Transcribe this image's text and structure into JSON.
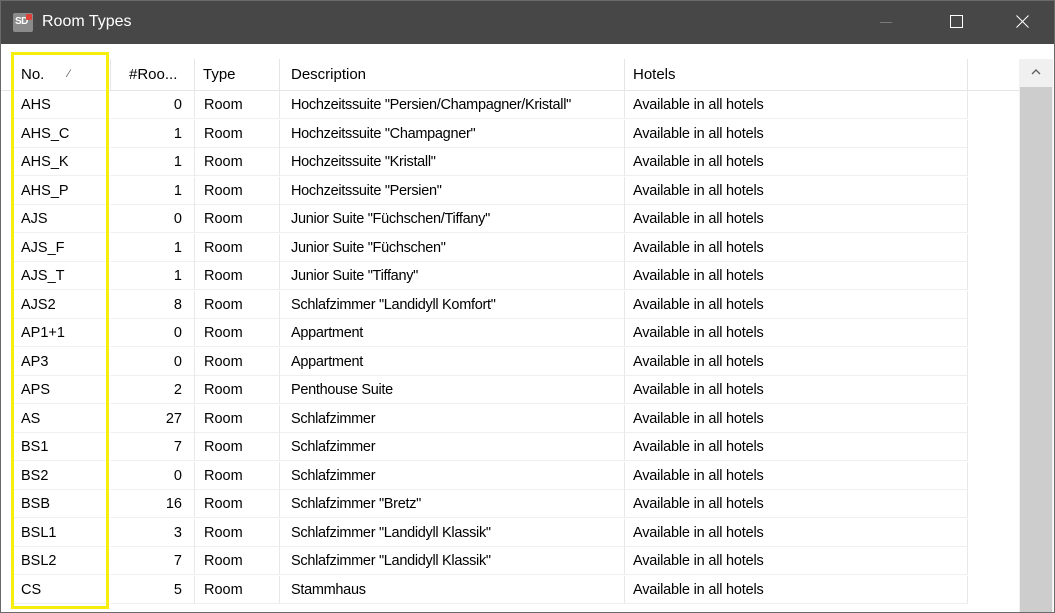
{
  "window": {
    "title": "Room Types",
    "app_icon_text": "SD"
  },
  "columns": {
    "no": "No.",
    "no_sort": "∕",
    "rooms": "#Roo...",
    "type": "Type",
    "description": "Description",
    "hotels": "Hotels"
  },
  "rows": [
    {
      "no": "AHS",
      "rooms": "0",
      "type": "Room",
      "description": "Hochzeitssuite \"Persien/Champagner/Kristall\"",
      "hotels": "Available in all hotels"
    },
    {
      "no": "AHS_C",
      "rooms": "1",
      "type": "Room",
      "description": "Hochzeitssuite \"Champagner\"",
      "hotels": "Available in all hotels"
    },
    {
      "no": "AHS_K",
      "rooms": "1",
      "type": "Room",
      "description": "Hochzeitssuite \"Kristall\"",
      "hotels": "Available in all hotels"
    },
    {
      "no": "AHS_P",
      "rooms": "1",
      "type": "Room",
      "description": "Hochzeitssuite \"Persien\"",
      "hotels": "Available in all hotels"
    },
    {
      "no": "AJS",
      "rooms": "0",
      "type": "Room",
      "description": "Junior Suite \"Füchschen/Tiffany\"",
      "hotels": "Available in all hotels"
    },
    {
      "no": "AJS_F",
      "rooms": "1",
      "type": "Room",
      "description": "Junior Suite \"Füchschen\"",
      "hotels": "Available in all hotels"
    },
    {
      "no": "AJS_T",
      "rooms": "1",
      "type": "Room",
      "description": "Junior Suite \"Tiffany\"",
      "hotels": "Available in all hotels"
    },
    {
      "no": "AJS2",
      "rooms": "8",
      "type": "Room",
      "description": "Schlafzimmer \"Landidyll Komfort\"",
      "hotels": "Available in all hotels"
    },
    {
      "no": "AP1+1",
      "rooms": "0",
      "type": "Room",
      "description": "Appartment",
      "hotels": "Available in all hotels"
    },
    {
      "no": "AP3",
      "rooms": "0",
      "type": "Room",
      "description": "Appartment",
      "hotels": "Available in all hotels"
    },
    {
      "no": "APS",
      "rooms": "2",
      "type": "Room",
      "description": "Penthouse Suite",
      "hotels": "Available in all hotels"
    },
    {
      "no": "AS",
      "rooms": "27",
      "type": "Room",
      "description": "Schlafzimmer",
      "hotels": "Available in all hotels"
    },
    {
      "no": "BS1",
      "rooms": "7",
      "type": "Room",
      "description": "Schlafzimmer",
      "hotels": "Available in all hotels"
    },
    {
      "no": "BS2",
      "rooms": "0",
      "type": "Room",
      "description": "Schlafzimmer",
      "hotels": "Available in all hotels"
    },
    {
      "no": "BSB",
      "rooms": "16",
      "type": "Room",
      "description": "Schlafzimmer \"Bretz\"",
      "hotels": "Available in all hotels"
    },
    {
      "no": "BSL1",
      "rooms": "3",
      "type": "Room",
      "description": "Schlafzimmer \"Landidyll Klassik\"",
      "hotels": "Available in all hotels"
    },
    {
      "no": "BSL2",
      "rooms": "7",
      "type": "Room",
      "description": "Schlafzimmer \"Landidyll Klassik\"",
      "hotels": "Available in all hotels"
    },
    {
      "no": "CS",
      "rooms": "5",
      "type": "Room",
      "description": "Stammhaus",
      "hotels": "Available in all hotels"
    }
  ],
  "colors": {
    "titlebar": "#474747",
    "highlight": "#f6ee0c",
    "scroll_thumb": "#cdcdcd"
  }
}
